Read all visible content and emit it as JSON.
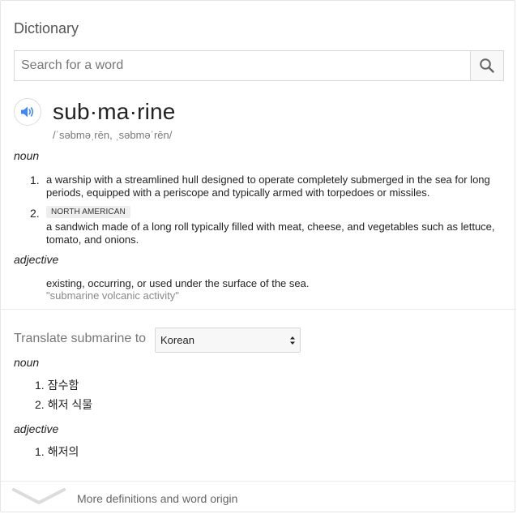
{
  "card": {
    "title": "Dictionary"
  },
  "search": {
    "placeholder": "Search for a word",
    "value": ""
  },
  "entry": {
    "headword": "sub·ma·rine",
    "phonetic": "/ˈsəbməˌrēn, ˌsəbməˈrēn/",
    "noun": {
      "label": "noun",
      "senses": [
        {
          "number": "1.",
          "text_line1": "a warship with a streamlined hull designed to operate completely submerged in the sea for long",
          "text_line2": "periods, equipped with a periscope and typically armed with torpedoes or missiles."
        },
        {
          "number": "2.",
          "region": "NORTH AMERICAN",
          "text_line1": "a sandwich made of a long roll typically filled with meat, cheese, and vegetables such as lettuce,",
          "text_line2": "tomato, and onions."
        }
      ]
    },
    "adjective": {
      "label": "adjective",
      "text": "existing, occurring, or used under the surface of the sea.",
      "example": "\"submarine volcanic activity\""
    }
  },
  "translate": {
    "label": "Translate submarine to",
    "selected_language": "Korean",
    "noun_label": "noun",
    "noun_items": [
      {
        "n": "1.",
        "text": "잠수함"
      },
      {
        "n": "2.",
        "text": "해저 식물"
      }
    ],
    "adjective_label": "adjective",
    "adjective_items": [
      {
        "n": "1.",
        "text": "해저의"
      }
    ]
  },
  "footer": {
    "more_label": "More definitions and word origin"
  },
  "colors": {
    "accent": "#4285f4",
    "muted": "#777777"
  }
}
